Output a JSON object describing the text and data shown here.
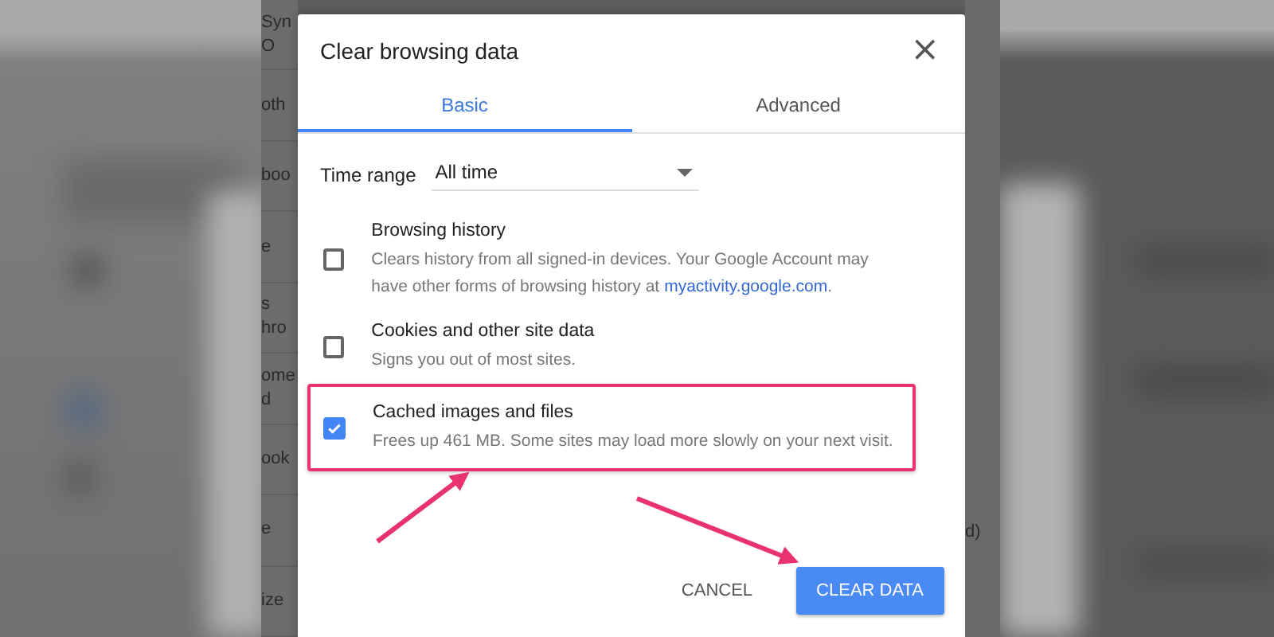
{
  "background_fragments": [
    {
      "lines": [
        "Syn",
        "O"
      ]
    },
    {
      "lines": [
        "oth"
      ]
    },
    {
      "lines": [
        "boo"
      ]
    },
    {
      "lines": [
        "e"
      ]
    },
    {
      "lines": [
        "s",
        "hro"
      ]
    },
    {
      "lines": [
        "ome",
        "d"
      ]
    },
    {
      "lines": [
        "ook"
      ]
    },
    {
      "lines": [
        "e"
      ]
    },
    {
      "lines": [
        "ize"
      ]
    }
  ],
  "right_fragment": "d)",
  "dialog": {
    "title": "Clear browsing data",
    "close": "×",
    "tabs": [
      {
        "label": "Basic",
        "selected": true
      },
      {
        "label": "Advanced",
        "selected": false
      }
    ],
    "time_range": {
      "label": "Time range",
      "value": "All time"
    },
    "items": [
      {
        "title": "Browsing history",
        "description": "Clears history from all signed-in devices. Your Google Account may have other forms of browsing history at",
        "link": "myactivity.google.com",
        "description_end": ".",
        "checked": false,
        "highlighted": false
      },
      {
        "title": "Cookies and other site data",
        "description": "Signs you out of most sites.",
        "checked": false,
        "highlighted": false
      },
      {
        "title": "Cached images and files",
        "description": "Frees up 461 MB. Some sites may load more slowly on your next visit.",
        "checked": true,
        "highlighted": true
      }
    ],
    "buttons": [
      {
        "label": "CANCEL",
        "kind": "text"
      },
      {
        "label": "CLEAR DATA",
        "kind": "primary"
      }
    ]
  }
}
